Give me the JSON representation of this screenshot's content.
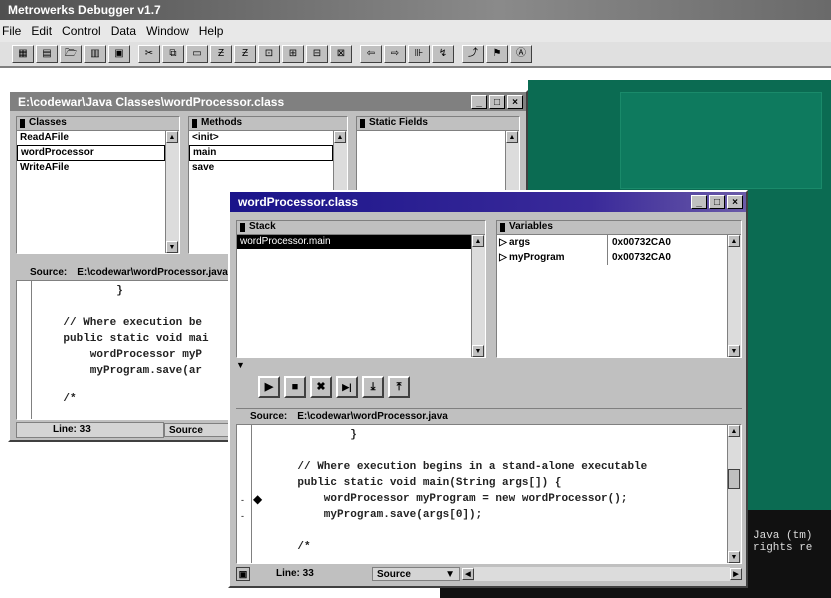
{
  "app": {
    "title": "Metrowerks Debugger v1.7"
  },
  "menu": [
    "File",
    "Edit",
    "Control",
    "Data",
    "Window",
    "Help"
  ],
  "toolbar": {
    "icons": [
      "stack-icon",
      "stack2-icon",
      "folder-icon",
      "doc-icon",
      "grid-icon",
      "cut-icon",
      "copy-icon",
      "paste-icon",
      "zoom-icon",
      "zoom2-icon",
      "window1-icon",
      "window2-icon",
      "window3-icon",
      "window4-icon",
      "back-icon",
      "forward-icon",
      "step-icon",
      "stepin-icon",
      "stepout-icon",
      "flag-icon",
      "text-icon"
    ],
    "glyphs": [
      "▦",
      "▤",
      "🗁",
      "▥",
      "▣",
      "✂",
      "⧉",
      "▭",
      "Ƶ",
      "Ƶ",
      "⊡",
      "⊞",
      "⊟",
      "⊠",
      "⇦",
      "⇨",
      "⊪",
      "↯",
      "⤴",
      "⚑",
      "Ⓐ"
    ]
  },
  "class_window": {
    "title": "E:\\codewar\\Java Classes\\wordProcessor.class",
    "classes_title": "Classes",
    "classes": [
      "ReadAFile",
      "wordProcessor",
      "WriteAFile"
    ],
    "methods_title": "Methods",
    "methods": [
      "<init>",
      "main",
      "save"
    ],
    "fields_title": "Static Fields",
    "source_label": "Source:",
    "source_path": "E:\\codewar\\wordProcessor.java",
    "code_lines": [
      "            }",
      "",
      "    // Where execution be",
      "    public static void mai",
      "        wordProcessor myP",
      "        myProgram.save(ar",
      "",
      "    /*"
    ],
    "line_label": "Line: 33",
    "mode": "Source"
  },
  "debug_window": {
    "title": "wordProcessor.class",
    "stack_title": "Stack",
    "stack_items": [
      "wordProcessor.main"
    ],
    "variables_title": "Variables",
    "variables": [
      {
        "name": "args",
        "value": "0x00732CA0"
      },
      {
        "name": "myProgram",
        "value": "0x00732CA0"
      }
    ],
    "controls": [
      "▶",
      "■",
      "✖",
      "▶|",
      "⤓",
      "⤒"
    ],
    "source_label": "Source:",
    "source_path": "E:\\codewar\\wordProcessor.java",
    "code_lines": [
      "            }",
      "",
      "    // Where execution begins in a stand-alone executable",
      "    public static void main(String args[]) {",
      "        wordProcessor myProgram = new wordProcessor();",
      "        myProgram.save(args[0]);",
      "",
      "    /*"
    ],
    "line_label": "Line: 33",
    "mode": "Source"
  },
  "console": {
    "lines": [
      "Java (tm)",
      "rights re"
    ]
  },
  "colors": {
    "desktop": "#0b6b52",
    "active_title": "#1a148a",
    "inactive_title": "#808080"
  }
}
